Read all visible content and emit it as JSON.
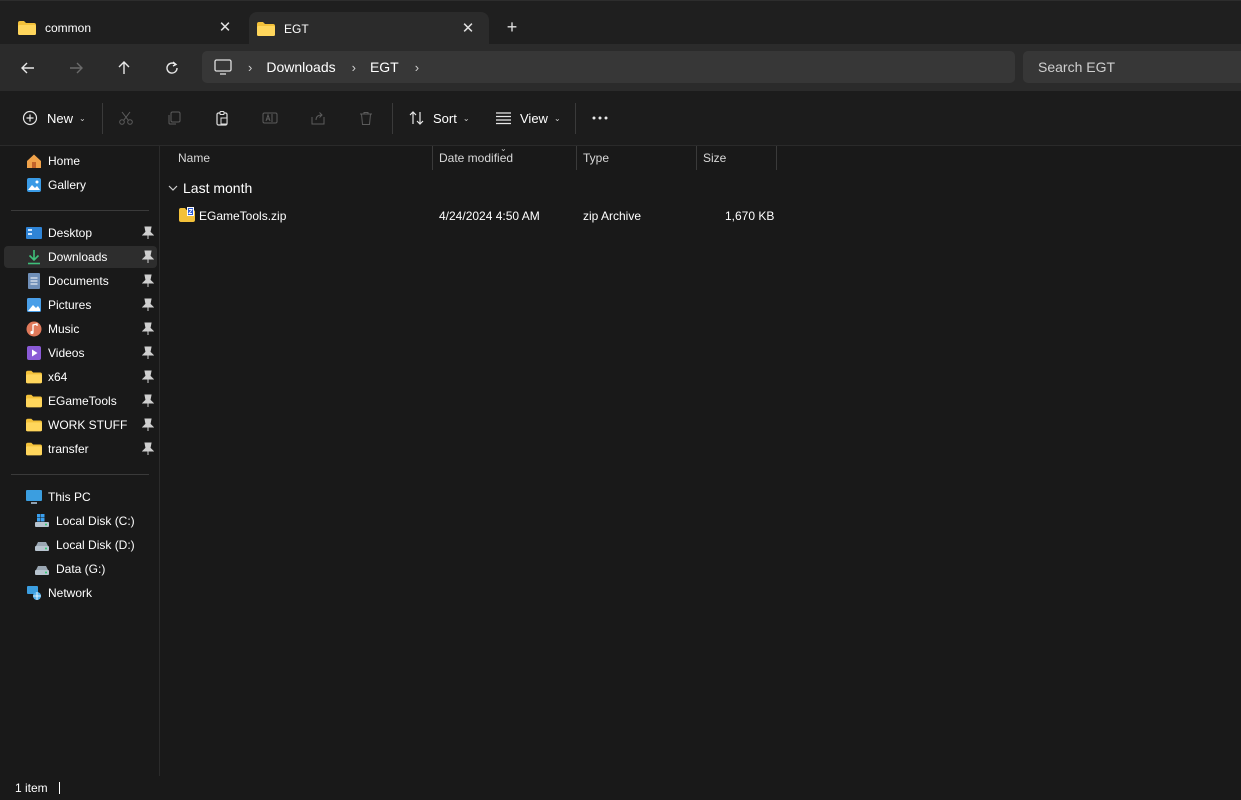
{
  "tabs": [
    {
      "label": "common",
      "icon": "folder-icon",
      "active": false
    },
    {
      "label": "EGT",
      "icon": "folder-icon",
      "active": true
    }
  ],
  "tab_close_glyph": "✕",
  "new_tab_glyph": "+",
  "address": {
    "root_icon": "this-pc-icon",
    "separator": "›",
    "crumbs": [
      "Downloads",
      "EGT"
    ]
  },
  "search": {
    "placeholder": "Search EGT"
  },
  "toolbar": {
    "new_label": "New",
    "sort_label": "Sort",
    "view_label": "View",
    "caret": "⌄"
  },
  "nav": {
    "quick": [
      {
        "label": "Home",
        "icon": "home-icon",
        "pinned": false
      },
      {
        "label": "Gallery",
        "icon": "gallery-icon",
        "pinned": false
      }
    ],
    "pinned": [
      {
        "label": "Desktop",
        "icon": "desktop-icon"
      },
      {
        "label": "Downloads",
        "icon": "downloads-icon",
        "selected": true
      },
      {
        "label": "Documents",
        "icon": "documents-icon"
      },
      {
        "label": "Pictures",
        "icon": "pictures-icon"
      },
      {
        "label": "Music",
        "icon": "music-icon"
      },
      {
        "label": "Videos",
        "icon": "videos-icon"
      },
      {
        "label": "x64",
        "icon": "folder-icon"
      },
      {
        "label": "EGameTools",
        "icon": "folder-icon"
      },
      {
        "label": "WORK STUFF",
        "icon": "folder-icon"
      },
      {
        "label": "transfer",
        "icon": "folder-icon"
      }
    ],
    "this_pc": {
      "label": "This PC",
      "icon": "this-pc-icon"
    },
    "drives": [
      {
        "label": "Local Disk (C:)",
        "icon": "windows-drive-icon"
      },
      {
        "label": "Local Disk (D:)",
        "icon": "drive-icon"
      },
      {
        "label": "Data (G:)",
        "icon": "drive-icon"
      }
    ],
    "network": {
      "label": "Network",
      "icon": "network-icon"
    }
  },
  "columns": {
    "name": "Name",
    "date": "Date modified",
    "type": "Type",
    "size": "Size"
  },
  "group": {
    "label": "Last month"
  },
  "files": [
    {
      "name": "EGameTools.zip",
      "date": "4/24/2024 4:50 AM",
      "type": "zip Archive",
      "size": "1,670 KB",
      "icon": "zip-icon"
    }
  ],
  "status": {
    "count": "1 item"
  }
}
